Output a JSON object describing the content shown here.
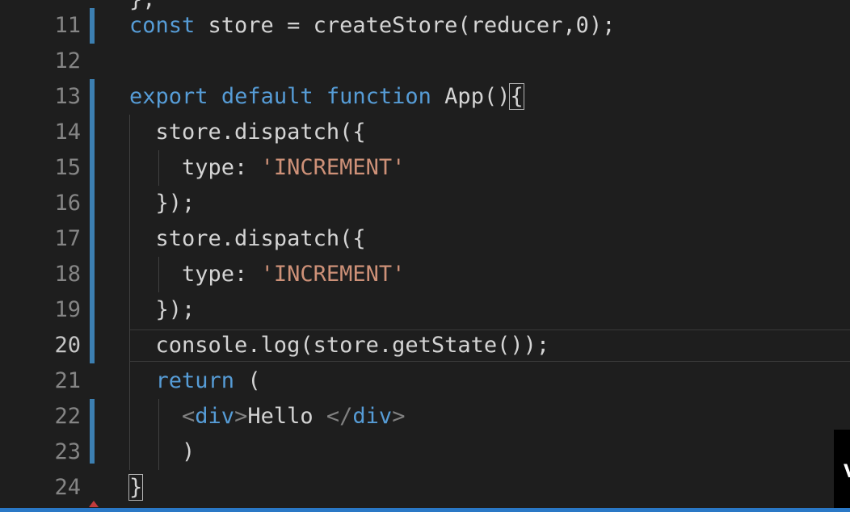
{
  "editor": {
    "top_sliver_text": "};",
    "lines": [
      {
        "number": "11",
        "tokens": [
          {
            "t": "const",
            "c": "kw"
          },
          {
            "t": " store = createStore(reducer,0);",
            "c": ""
          }
        ]
      },
      {
        "number": "12",
        "tokens": []
      },
      {
        "number": "13",
        "tokens": [
          {
            "t": "export",
            "c": "kw"
          },
          {
            "t": " ",
            "c": ""
          },
          {
            "t": "default",
            "c": "kw"
          },
          {
            "t": " ",
            "c": ""
          },
          {
            "t": "function",
            "c": "kw"
          },
          {
            "t": " App()",
            "c": ""
          },
          {
            "t": "{",
            "c": "bracket"
          }
        ]
      },
      {
        "number": "14",
        "tokens": [
          {
            "t": "  store.dispatch({",
            "c": ""
          }
        ]
      },
      {
        "number": "15",
        "tokens": [
          {
            "t": "    type: ",
            "c": ""
          },
          {
            "t": "'INCREMENT'",
            "c": "str"
          }
        ]
      },
      {
        "number": "16",
        "tokens": [
          {
            "t": "  });",
            "c": ""
          }
        ]
      },
      {
        "number": "17",
        "tokens": [
          {
            "t": "  store.dispatch({",
            "c": ""
          }
        ]
      },
      {
        "number": "18",
        "tokens": [
          {
            "t": "    type: ",
            "c": ""
          },
          {
            "t": "'INCREMENT'",
            "c": "str"
          }
        ]
      },
      {
        "number": "19",
        "tokens": [
          {
            "t": "  });",
            "c": ""
          }
        ]
      },
      {
        "number": "20",
        "tokens": [
          {
            "t": "  console.log(store.getState());",
            "c": ""
          }
        ]
      },
      {
        "number": "21",
        "tokens": [
          {
            "t": "  ",
            "c": ""
          },
          {
            "t": "return",
            "c": "kw"
          },
          {
            "t": " (",
            "c": ""
          }
        ]
      },
      {
        "number": "22",
        "tokens": [
          {
            "t": "    ",
            "c": ""
          },
          {
            "t": "<",
            "c": "ptag"
          },
          {
            "t": "div",
            "c": "tag"
          },
          {
            "t": ">",
            "c": "ptag"
          },
          {
            "t": "Hello ",
            "c": ""
          },
          {
            "t": "</",
            "c": "ptag"
          },
          {
            "t": "div",
            "c": "tag"
          },
          {
            "t": ">",
            "c": "ptag"
          }
        ]
      },
      {
        "number": "23",
        "tokens": [
          {
            "t": "    )",
            "c": ""
          }
        ]
      },
      {
        "number": "24",
        "tokens": [
          {
            "t": "}",
            "c": "bracket"
          }
        ]
      }
    ],
    "active_line": "20",
    "overlay_letter": "V"
  },
  "colors": {
    "background": "#1e1e1e",
    "keyword": "#569cd6",
    "string": "#ce9178",
    "modified_gutter": "#3c7fb1",
    "status_bar": "#2a78c6"
  }
}
